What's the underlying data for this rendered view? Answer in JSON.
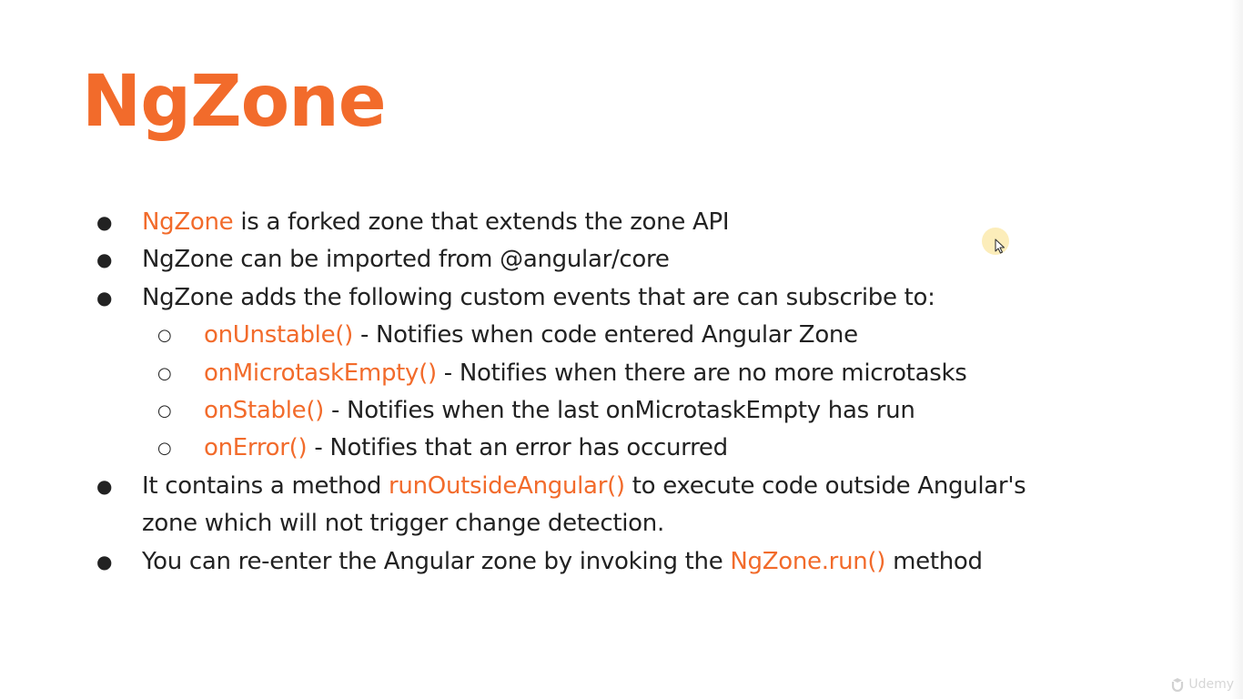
{
  "slide": {
    "title": "NgZone",
    "bullets": [
      {
        "highlight": "NgZone",
        "text": " is a forked zone that extends the zone API"
      },
      {
        "text": "NgZone can be imported from @angular/core"
      },
      {
        "text": "NgZone adds the following custom events that are can subscribe to:"
      }
    ],
    "sub_bullets": [
      {
        "highlight": "onUnstable()",
        "text": " - Notifies when code entered Angular Zone"
      },
      {
        "highlight": "onMicrotaskEmpty()",
        "text": " - Notifies when there are no more microtasks"
      },
      {
        "highlight": "onStable()",
        "text": " - Notifies when the last onMicrotaskEmpty has run"
      },
      {
        "highlight": "onError()",
        "text": " - Notifies that an error has occurred"
      }
    ],
    "bullet_run_outside": {
      "before": "It contains a method ",
      "highlight": "runOutsideAngular()",
      "after": " to execute code outside Angular's",
      "continuation": "zone which will not trigger change detection."
    },
    "bullet_reenter": {
      "before": "You can re-enter the Angular zone by invoking the ",
      "highlight": "NgZone.run()",
      "after": " method"
    }
  },
  "watermark": {
    "text": "Udemy",
    "icon": "udemy-logo-icon"
  },
  "colors": {
    "accent": "#f26b2b",
    "text": "#222222",
    "background": "#ffffff"
  }
}
